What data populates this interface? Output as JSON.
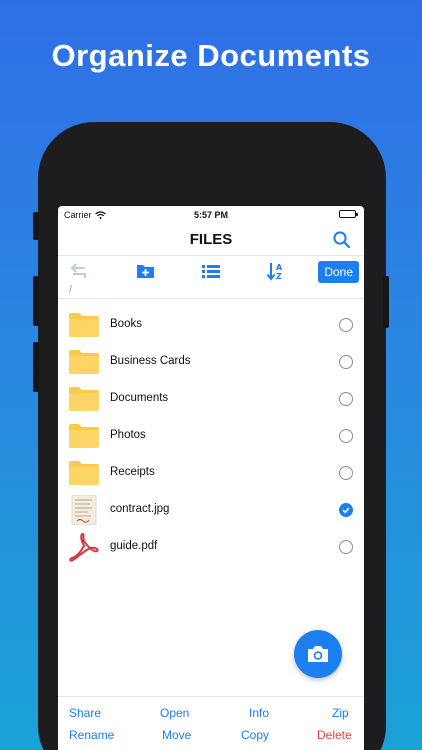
{
  "promo": {
    "headline": "Organize Documents"
  },
  "status_bar": {
    "carrier": "Carrier",
    "time": "5:57 PM"
  },
  "nav": {
    "title": "FILES",
    "search_icon": "search-icon"
  },
  "toolbar": {
    "done_label": "Done",
    "icons": [
      "back-icon",
      "new-folder-icon",
      "list-view-icon",
      "sort-az-icon"
    ]
  },
  "path": "/",
  "files": [
    {
      "name": "Books",
      "type": "folder",
      "selected": false
    },
    {
      "name": "Business Cards",
      "type": "folder",
      "selected": false
    },
    {
      "name": "Documents",
      "type": "folder",
      "selected": false
    },
    {
      "name": "Photos",
      "type": "folder",
      "selected": false
    },
    {
      "name": "Receipts",
      "type": "folder",
      "selected": false
    },
    {
      "name": "contract.jpg",
      "type": "image",
      "selected": true
    },
    {
      "name": "guide.pdf",
      "type": "pdf",
      "selected": false
    }
  ],
  "actions": {
    "share": "Share",
    "open": "Open",
    "info": "Info",
    "zip": "Zip",
    "rename": "Rename",
    "move": "Move",
    "copy": "Copy",
    "delete": "Delete"
  },
  "colors": {
    "accent": "#1b7ff0",
    "folder": "#fcc94a",
    "danger": "#e8433a",
    "pdf": "#d13a44"
  }
}
